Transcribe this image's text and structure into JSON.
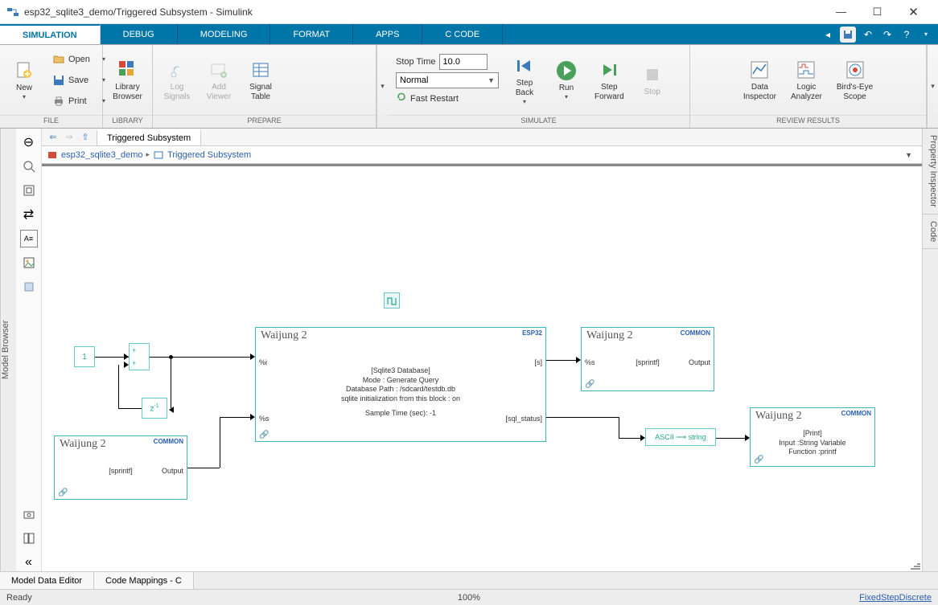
{
  "window": {
    "title": "esp32_sqlite3_demo/Triggered Subsystem - Simulink"
  },
  "tabs": [
    "SIMULATION",
    "DEBUG",
    "MODELING",
    "FORMAT",
    "APPS",
    "C CODE"
  ],
  "active_tab_index": 0,
  "file_group": {
    "new": "New",
    "open": "Open",
    "save": "Save",
    "print": "Print",
    "label": "FILE"
  },
  "library_group": {
    "browser": "Library\nBrowser",
    "label": "LIBRARY"
  },
  "prepare_group": {
    "log": "Log\nSignals",
    "add": "Add\nViewer",
    "table": "Signal\nTable",
    "label": "PREPARE"
  },
  "simulate_group": {
    "stoptime_label": "Stop Time",
    "stoptime_value": "10.0",
    "mode": "Normal",
    "fast_restart": "Fast Restart",
    "step_back": "Step\nBack",
    "run": "Run",
    "step_forward": "Step\nForward",
    "stop": "Stop",
    "label": "SIMULATE"
  },
  "review_group": {
    "data_inspector": "Data\nInspector",
    "logic_analyzer": "Logic\nAnalyzer",
    "birds_eye": "Bird's-Eye\nScope",
    "label": "REVIEW RESULTS"
  },
  "sidebars": {
    "model_browser": "Model Browser",
    "prop_inspector": "Property Inspector",
    "code": "Code"
  },
  "doc_tab": "Triggered Subsystem",
  "breadcrumb": {
    "root": "esp32_sqlite3_demo",
    "leaf": "Triggered Subsystem"
  },
  "blocks": {
    "const1": "1",
    "sum_ops": [
      "+",
      "+"
    ],
    "delay": "z",
    "delay_exp": "-1",
    "sprintf1": {
      "title": "Waijung 2",
      "chip": "COMMON",
      "center": "[sprintf]",
      "out": "Output"
    },
    "sqlite": {
      "title": "Waijung 2",
      "chip": "ESP32",
      "in1": "%i",
      "in2": "%s",
      "out1": "[s]",
      "out2": "[sql_status]",
      "l1": "[Sqlite3 Database]",
      "l2": "Mode : Generate Query",
      "l3": "Database Path : /sdcard/testdb.db",
      "l4": "sqlite initialization from this block : on",
      "l5": "Sample Time (sec): -1"
    },
    "sprintf2": {
      "title": "Waijung 2",
      "chip": "COMMON",
      "in": "%s",
      "center": "[sprintf]",
      "out": "Output"
    },
    "ascii": "ASCII ⟶ string",
    "print": {
      "title": "Waijung 2",
      "chip": "COMMON",
      "l1": "[Print]",
      "l2": "Input :String Variable",
      "l3": "Function :printf"
    }
  },
  "bottom_tabs": [
    "Model Data Editor",
    "Code Mappings - C"
  ],
  "status": {
    "ready": "Ready",
    "zoom": "100%",
    "solver": "FixedStepDiscrete"
  }
}
